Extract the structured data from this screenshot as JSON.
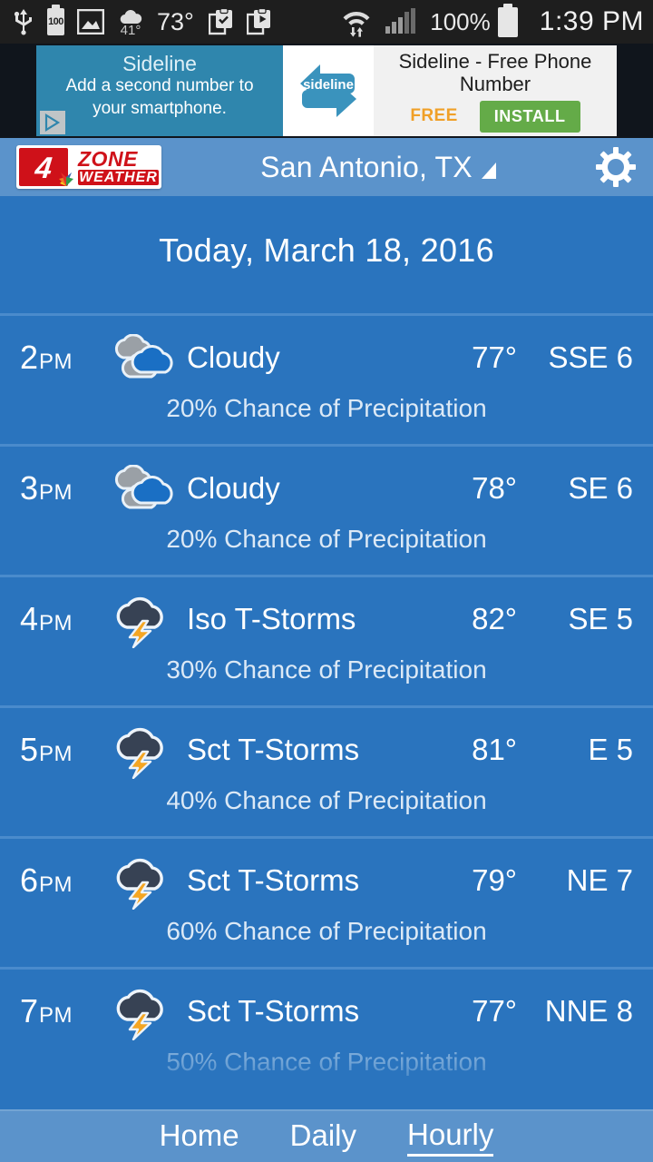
{
  "statusbar": {
    "usb_icon": "usb-icon",
    "battery_level_text": "100",
    "gallery_icon": "image-icon",
    "weather_widget_temp": "41",
    "weather_widget_degree": "°",
    "temp_text": "73°",
    "clipboard_check_icon": "clipboard-check-icon",
    "clipboard_play_icon": "clipboard-play-icon",
    "wifi_icon": "wifi-data-icon",
    "signal_icon": "cell-signal-icon",
    "battery_percent": "100%",
    "clock": "1:39 PM"
  },
  "ad": {
    "brand": "Sideline",
    "tagline_line1": "Add a second number to",
    "tagline_line2": "your smartphone.",
    "badge_text": "sideline",
    "title": "Sideline - Free Phone Number",
    "price_label": "FREE",
    "install_label": "INSTALL",
    "adchoices_icon": "adchoices-icon"
  },
  "header": {
    "logo": {
      "channel": "4",
      "zone": "ZONE",
      "weather": "WEATHER",
      "peacock_icon": "nbc-peacock-icon"
    },
    "city": "San Antonio, TX",
    "caret_icon": "dropdown-caret-icon",
    "settings_icon": "gear-icon"
  },
  "date_header": "Today, March 18, 2016",
  "hours": [
    {
      "time": "2",
      "ampm": "PM",
      "icon": "cloudy-icon",
      "condition": "Cloudy",
      "temp": "77°",
      "wind": "SSE 6",
      "precip": "20% Chance of Precipitation"
    },
    {
      "time": "3",
      "ampm": "PM",
      "icon": "cloudy-icon",
      "condition": "Cloudy",
      "temp": "78°",
      "wind": "SE 6",
      "precip": "20% Chance of Precipitation"
    },
    {
      "time": "4",
      "ampm": "PM",
      "icon": "thunderstorm-icon",
      "condition": "Iso T-Storms",
      "temp": "82°",
      "wind": "SE 5",
      "precip": "30% Chance of Precipitation"
    },
    {
      "time": "5",
      "ampm": "PM",
      "icon": "thunderstorm-icon",
      "condition": "Sct T-Storms",
      "temp": "81°",
      "wind": "E 5",
      "precip": "40% Chance of Precipitation"
    },
    {
      "time": "6",
      "ampm": "PM",
      "icon": "thunderstorm-icon",
      "condition": "Sct T-Storms",
      "temp": "79°",
      "wind": "NE 7",
      "precip": "60% Chance of Precipitation"
    },
    {
      "time": "7",
      "ampm": "PM",
      "icon": "thunderstorm-icon",
      "condition": "Sct T-Storms",
      "temp": "77°",
      "wind": "NNE 8",
      "precip": "50% Chance of Precipitation"
    }
  ],
  "bottom_nav": {
    "items": [
      {
        "label": "Home",
        "active": false
      },
      {
        "label": "Daily",
        "active": false
      },
      {
        "label": "Hourly",
        "active": true
      }
    ]
  },
  "colors": {
    "app_background": "#2a74be",
    "header_bar": "#5b93cb",
    "row_divider": "#4a8bcc",
    "accent_white": "#ffffff",
    "status_bar": "#1e1e1e",
    "logo_red": "#cf1119",
    "ad_install_green": "#64ab48",
    "ad_free_orange": "#f0a028",
    "lightning_orange": "#f5a623",
    "storm_cloud": "#374254"
  }
}
